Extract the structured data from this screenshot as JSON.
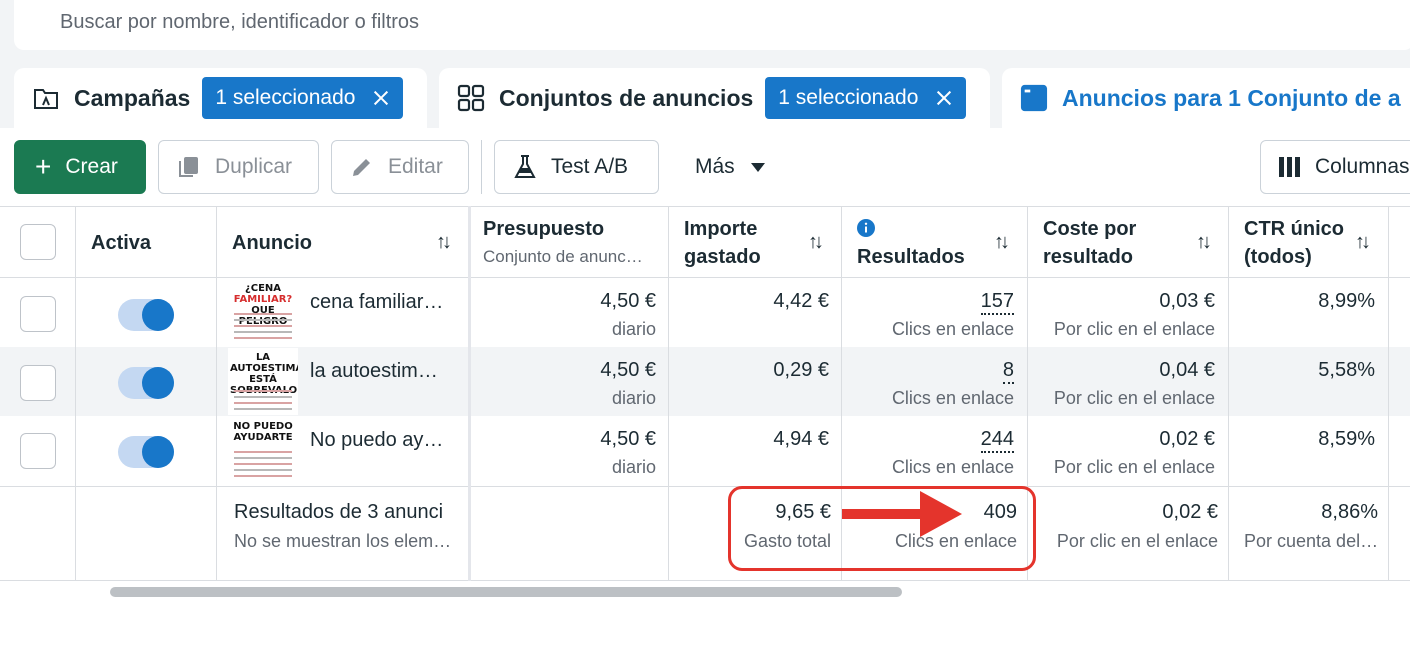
{
  "search": {
    "placeholder": "Buscar por nombre, identificador o filtros"
  },
  "tabs": {
    "campaigns": {
      "title": "Campañas",
      "chip": "1 seleccionado"
    },
    "adsets": {
      "title": "Conjuntos de anuncios",
      "chip": "1 seleccionado"
    },
    "ads": {
      "title": "Anuncios para 1 Conjunto de a"
    }
  },
  "toolbar": {
    "create": "Crear",
    "duplicate": "Duplicar",
    "edit": "Editar",
    "ab_test": "Test A/B",
    "more": "Más",
    "columns": "Columnas"
  },
  "table": {
    "headers": {
      "active": "Activa",
      "ad": "Anuncio",
      "budget": "Presupuesto",
      "budget_sub": "Conjunto de anunc…",
      "spent_1": "Importe",
      "spent_2": "gastado",
      "results": "Resultados",
      "cost_1": "Coste por",
      "cost_2": "resultado",
      "ctr_1": "CTR único",
      "ctr_2": "(todos)"
    },
    "rows": [
      {
        "thumb_lines": [
          "¿CENA",
          "FAMILIAR?",
          "QUE PELIGRO"
        ],
        "name": "cena familiar…",
        "budget": "4,50 €",
        "budget_sub": "diario",
        "spent": "4,42 €",
        "results": "157",
        "results_sub": "Clics en enlace",
        "cost": "0,03 €",
        "cost_sub": "Por clic en el enlace",
        "ctr": "8,99%"
      },
      {
        "thumb_lines": [
          "LA AUTOESTIMA",
          "ESTÁ",
          "SOBREVALORADA"
        ],
        "name": "la autoestim…",
        "budget": "4,50 €",
        "budget_sub": "diario",
        "spent": "0,29 €",
        "results": "8",
        "results_sub": "Clics en enlace",
        "cost": "0,04 €",
        "cost_sub": "Por clic en el enlace",
        "ctr": "5,58%"
      },
      {
        "thumb_lines": [
          "NO PUEDO",
          "AYUDARTE"
        ],
        "name": "No puedo ay…",
        "budget": "4,50 €",
        "budget_sub": "diario",
        "spent": "4,94 €",
        "results": "244",
        "results_sub": "Clics en enlace",
        "cost": "0,02 €",
        "cost_sub": "Por clic en el enlace",
        "ctr": "8,59%"
      }
    ],
    "totals": {
      "label": "Resultados de 3 anunci",
      "label_sub": "No se muestran los elem…",
      "spent": "9,65 €",
      "spent_sub": "Gasto total",
      "results": "409",
      "results_sub": "Clics en enlace",
      "cost": "0,02 €",
      "cost_sub": "Por clic en el enlace",
      "ctr": "8,86%",
      "ctr_sub": "Por cuenta del…"
    }
  },
  "colors": {
    "accent": "#1877c9",
    "create": "#1b7a52",
    "annotation": "#e4342c"
  }
}
